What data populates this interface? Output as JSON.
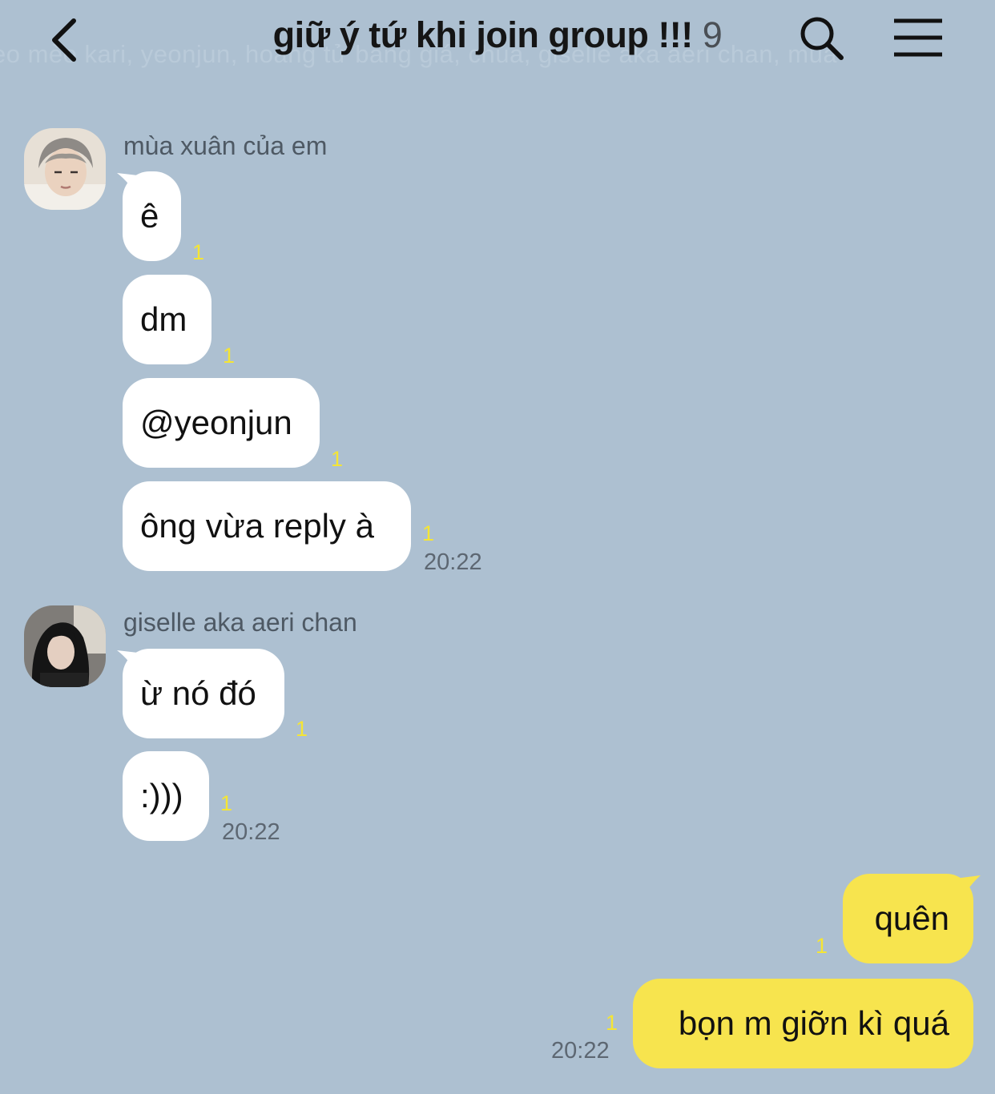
{
  "header": {
    "back_icon": "chevron-left-icon",
    "title": "giữ ý tứ khi join group !!!",
    "member_count": "9",
    "members_preview": "eo mèo kari, yeonjun, hoàng tử băng giá, chúa, giselle aka aeri chan, mùa",
    "search_icon": "search-icon",
    "menu_icon": "hamburger-menu-icon"
  },
  "colors": {
    "background": "#adc0d1",
    "incoming_bubble": "#ffffff",
    "outgoing_bubble": "#f7e44e",
    "unread_count": "#f5e534"
  },
  "messages": {
    "group1": {
      "sender": "mùa xuân của em",
      "m1": {
        "text": "ê",
        "unread": "1"
      },
      "m2": {
        "text": "dm",
        "unread": "1"
      },
      "m3": {
        "text": "@yeonjun",
        "unread": "1"
      },
      "m4": {
        "text": "ông vừa reply à",
        "unread": "1",
        "time": "20:22"
      }
    },
    "group2": {
      "sender": "giselle aka aeri chan",
      "m1": {
        "text": "ừ nó đó",
        "unread": "1"
      },
      "m2": {
        "text": ":)))",
        "unread": "1",
        "time": "20:22"
      }
    },
    "group3": {
      "m1": {
        "text": "quên",
        "unread": "1"
      },
      "m2": {
        "text": "bọn m giỡn kì quá",
        "unread": "1",
        "time": "20:22"
      }
    }
  }
}
